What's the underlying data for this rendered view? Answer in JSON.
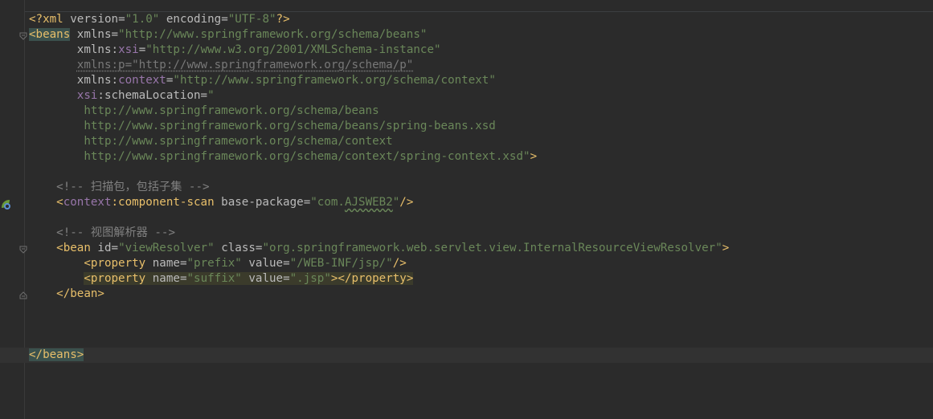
{
  "editor": {
    "l1": {
      "pi_open": "<?xml",
      "a1": " version",
      "v1": "\"1.0\"",
      "a2": " encoding",
      "v2": "\"UTF-8\"",
      "pi_close": "?>"
    },
    "l2": {
      "tag": "<beans",
      "attr": " xmlns",
      "val": "\"http://www.springframework.org/schema/beans\""
    },
    "l3": {
      "indent": "       ",
      "xmlns": "xmlns",
      "ns": "xsi",
      "val": "\"http://www.w3.org/2001/XMLSchema-instance\""
    },
    "l4": {
      "indent": "       ",
      "text": "xmlns:p=\"http://www.springframework.org/schema/p\""
    },
    "l5": {
      "indent": "       ",
      "xmlns": "xmlns",
      "ns": "context",
      "val": "\"http://www.springframework.org/schema/context\""
    },
    "l6": {
      "indent": "       ",
      "ns": "xsi",
      "attr": ":schemaLocation",
      "val": "\""
    },
    "l7": {
      "indent": "        ",
      "val": "http://www.springframework.org/schema/beans"
    },
    "l8": {
      "indent": "        ",
      "val": "http://www.springframework.org/schema/beans/spring-beans.xsd"
    },
    "l9": {
      "indent": "        ",
      "val": "http://www.springframework.org/schema/context"
    },
    "l10": {
      "indent": "        ",
      "val": "http://www.springframework.org/schema/context/spring-context.xsd\"",
      "close": ">"
    },
    "l12": {
      "indent": "    ",
      "comment": "<!-- 扫描包，包括子集 -->"
    },
    "l13": {
      "indent": "    ",
      "open": "<",
      "ns": "context",
      "tag": ":component-scan",
      "attr": " base-package",
      "val1": "\"com.",
      "val2": "AJSWEB2",
      "val3": "\"",
      "close": "/>"
    },
    "l15": {
      "indent": "    ",
      "comment": "<!-- 视图解析器 -->"
    },
    "l16": {
      "indent": "    ",
      "tag": "<bean",
      "a1": " id",
      "v1": "\"viewResolver\"",
      "a2": " class",
      "v2": "\"org.springframework.web.servlet.view.InternalResourceViewResolver\"",
      "close": ">"
    },
    "l17": {
      "indent": "        ",
      "tag": "<property",
      "a1": " name",
      "v1": "\"prefix\"",
      "a2": " value",
      "v2": "\"/WEB-INF/jsp/\"",
      "close": "/>"
    },
    "l18": {
      "indent": "        ",
      "tag": "<property",
      "a1": " name",
      "v1": "\"suffix\"",
      "a2": " value",
      "v2": "\".jsp\"",
      "close": "></property>"
    },
    "l19": {
      "indent": "    ",
      "tag": "</bean>"
    },
    "l23": {
      "tag": "</beans>"
    }
  }
}
